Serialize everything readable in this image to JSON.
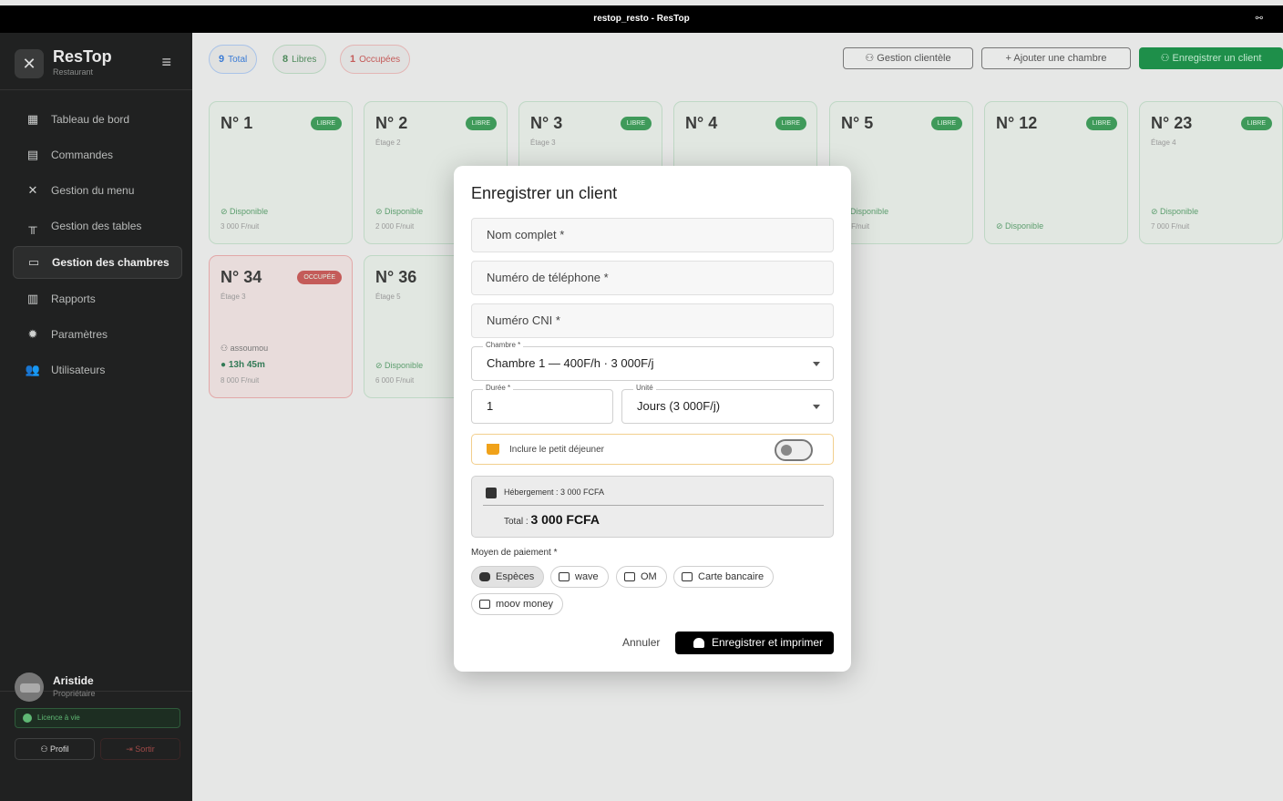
{
  "window": {
    "title": "restop_resto - ResTop",
    "icon": "link-icon"
  },
  "brand": {
    "name": "ResTop",
    "subtitle": "Restaurant"
  },
  "nav": [
    {
      "label": "Tableau de bord",
      "icon": "dashboard-icon"
    },
    {
      "label": "Commandes",
      "icon": "receipt-icon"
    },
    {
      "label": "Gestion du menu",
      "icon": "utensils-icon"
    },
    {
      "label": "Gestion des tables",
      "icon": "table-icon"
    },
    {
      "label": "Gestion des chambres",
      "icon": "bed-icon",
      "active": true
    },
    {
      "label": "Rapports",
      "icon": "report-icon"
    },
    {
      "label": "Paramètres",
      "icon": "gear-icon"
    },
    {
      "label": "Utilisateurs",
      "icon": "users-icon"
    }
  ],
  "user": {
    "name": "Aristide",
    "role": "Propriétaire",
    "licence": "Licence à vie",
    "profile": "Profil",
    "logout": "Sortir"
  },
  "stats": {
    "total_count": "9",
    "total_label": "Total",
    "free_count": "8",
    "free_label": "Libres",
    "busy_count": "1",
    "busy_label": "Occupées"
  },
  "actions": {
    "clients": "Gestion clientèle",
    "add_room": "Ajouter une chambre",
    "register": "Enregistrer un client"
  },
  "rooms": [
    {
      "num": "N° 1",
      "badge": "LIBRE",
      "floor": "",
      "status": "Disponible",
      "price": "3 000 F/nuit"
    },
    {
      "num": "N° 2",
      "badge": "LIBRE",
      "floor": "Étage 2",
      "status": "Disponible",
      "price": "2 000 F/nuit"
    },
    {
      "num": "N° 3",
      "badge": "LIBRE",
      "floor": "Étage 3",
      "status": "",
      "price": ""
    },
    {
      "num": "N° 4",
      "badge": "LIBRE",
      "floor": "",
      "status": "",
      "price": ""
    },
    {
      "num": "N° 5",
      "badge": "LIBRE",
      "floor": "",
      "status": "Disponible",
      "price": "00 F/nuit"
    },
    {
      "num": "N° 12",
      "badge": "LIBRE",
      "floor": "",
      "status": "Disponible",
      "price": ""
    },
    {
      "num": "N° 23",
      "badge": "LIBRE",
      "floor": "Étage 4",
      "status": "Disponible",
      "price": "7 000 F/nuit"
    },
    {
      "num": "N° 34",
      "badge": "OCCUPÉE",
      "floor": "Étage 3",
      "occupant": "assoumou",
      "time": "13h 45m",
      "price": "8 000 F/nuit"
    },
    {
      "num": "N° 36",
      "badge": "",
      "floor": "Étage 5",
      "status": "Disponible",
      "price": "6 000 F/nuit"
    }
  ],
  "modal": {
    "title": "Enregistrer un client",
    "name_placeholder": "Nom complet *",
    "phone_placeholder": "Numéro de téléphone *",
    "cni_placeholder": "Numéro CNI *",
    "room_label": "Chambre *",
    "room_value": "Chambre 1 — 400F/h · 3 000F/j",
    "duration_label": "Durée *",
    "duration_value": "1",
    "unit_label": "Unité",
    "unit_value": "Jours (3 000F/j)",
    "breakfast_label": "Inclure le petit déjeuner",
    "breakfast_on": false,
    "lodging": "Hébergement : 3 000 FCFA",
    "total_label": "Total :",
    "total_value": "3 000 FCFA",
    "payment_label": "Moyen de paiement *",
    "payments": [
      "Espèces",
      "wave",
      "OM",
      "Carte bancaire",
      "moov money"
    ],
    "payment_selected": "Espèces",
    "cancel": "Annuler",
    "submit": "Enregistrer et imprimer"
  },
  "colors": {
    "accent": "#1e8f4a",
    "occupied": "#c45b59",
    "sidebar": "#202121",
    "breakfast": "#f0a21a"
  }
}
